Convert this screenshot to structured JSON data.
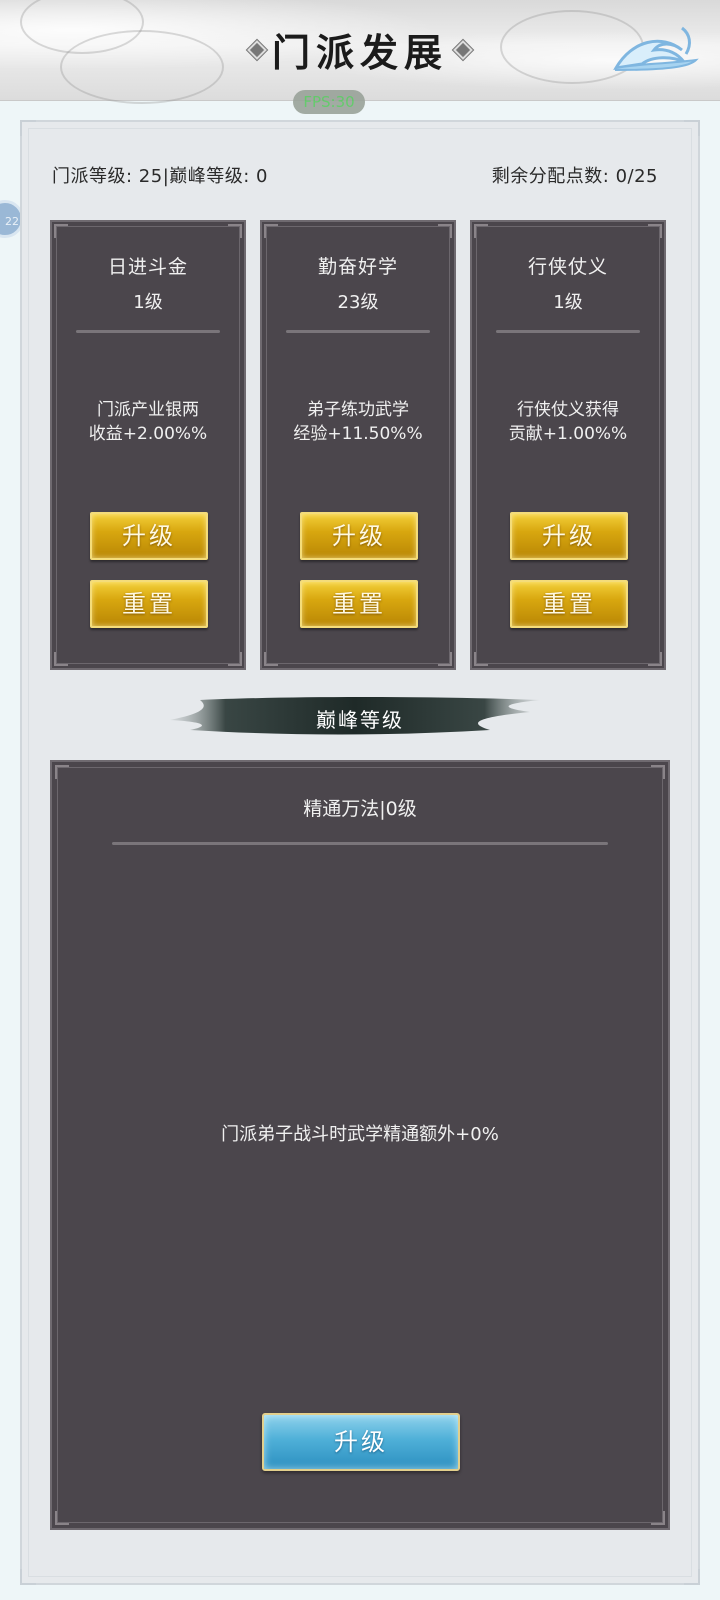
{
  "header": {
    "title": "门派发展",
    "fps": "FPS:30",
    "side_badge": "22"
  },
  "stats": {
    "left": "门派等级: 25|巅峰等级: 0",
    "right": "剩余分配点数: 0/25"
  },
  "cards": [
    {
      "title": "日进斗金",
      "level": "1级",
      "desc_line1": "门派产业银两",
      "desc_line2": "收益+2.00%%",
      "upgrade": "升级",
      "reset": "重置"
    },
    {
      "title": "勤奋好学",
      "level": "23级",
      "desc_line1": "弟子练功武学",
      "desc_line2": "经验+11.50%%",
      "upgrade": "升级",
      "reset": "重置"
    },
    {
      "title": "行侠仗义",
      "level": "1级",
      "desc_line1": "行侠仗义获得",
      "desc_line2": "贡献+1.00%%",
      "upgrade": "升级",
      "reset": "重置"
    }
  ],
  "peak": {
    "banner": "巅峰等级",
    "title": "精通万法|0级",
    "desc": "门派弟子战斗时武学精通额外+0%",
    "upgrade": "升级"
  }
}
